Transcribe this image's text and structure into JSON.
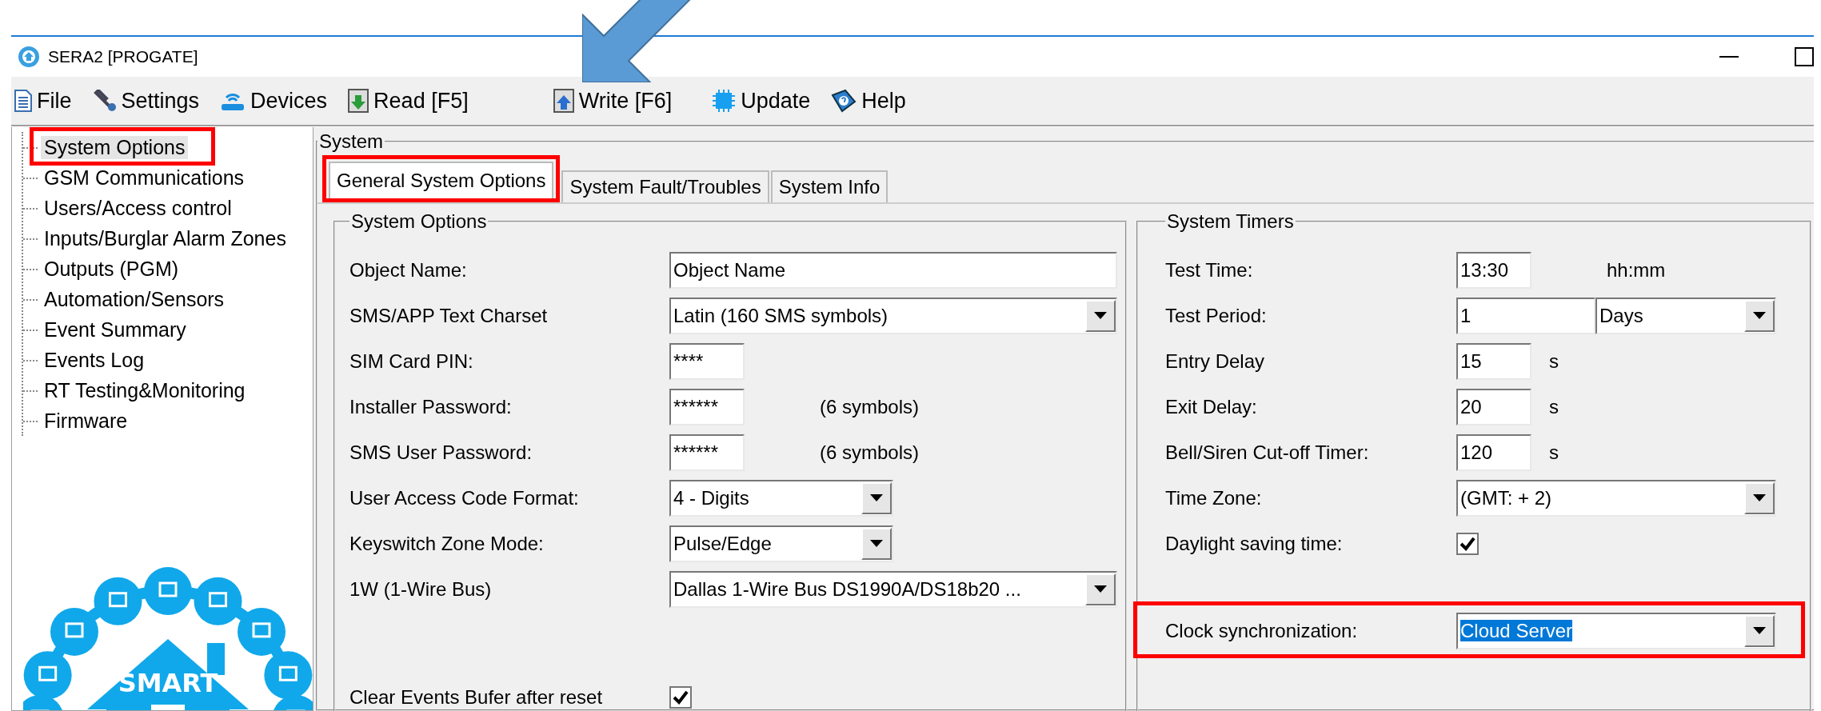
{
  "window": {
    "title": "SERA2 [PROGATE]"
  },
  "menu": [
    {
      "label": "File"
    },
    {
      "label": "Settings"
    },
    {
      "label": "Devices"
    },
    {
      "label": "Read [F5]"
    },
    {
      "label": "Write [F6]"
    },
    {
      "label": "Update"
    },
    {
      "label": "Help"
    }
  ],
  "sidebar": {
    "items": [
      {
        "label": "System Options",
        "selected": true,
        "highlighted": true
      },
      {
        "label": "GSM Communications",
        "selected": false,
        "highlighted": false
      },
      {
        "label": "Users/Access control",
        "selected": false,
        "highlighted": false
      },
      {
        "label": "Inputs/Burglar Alarm Zones",
        "selected": false,
        "highlighted": false
      },
      {
        "label": "Outputs (PGM)",
        "selected": false,
        "highlighted": false
      },
      {
        "label": "Automation/Sensors",
        "selected": false,
        "highlighted": false
      },
      {
        "label": "Event Summary",
        "selected": false,
        "highlighted": false
      },
      {
        "label": "Events Log",
        "selected": false,
        "highlighted": false
      },
      {
        "label": "RT Testing&Monitoring",
        "selected": false,
        "highlighted": false
      },
      {
        "label": "Firmware",
        "selected": false,
        "highlighted": false
      }
    ],
    "logo": {
      "text": "SMART"
    }
  },
  "panel": {
    "title": "System",
    "tabs": [
      {
        "label": "General System Options",
        "selected": true,
        "highlighted": true
      },
      {
        "label": "System Fault/Troubles",
        "selected": false,
        "highlighted": false
      },
      {
        "label": "System Info",
        "selected": false,
        "highlighted": false
      }
    ]
  },
  "system_options": {
    "title": "System Options",
    "rows": [
      {
        "kind": "text",
        "label": "Object Name:",
        "value": "Object Name"
      },
      {
        "kind": "select",
        "label": "SMS/APP Text Charset",
        "value": "Latin (160 SMS symbols)"
      },
      {
        "kind": "short-text",
        "label": "SIM Card PIN:",
        "value": "****"
      },
      {
        "kind": "short-text",
        "label": "Installer Password:",
        "value": "******",
        "note": "(6 symbols)"
      },
      {
        "kind": "short-text",
        "label": "SMS User Password:",
        "value": "******",
        "note": "(6 symbols)"
      },
      {
        "kind": "short-select",
        "label": "User Access Code Format:",
        "value": "4 - Digits"
      },
      {
        "kind": "short-select",
        "label": "Keyswitch Zone Mode:",
        "value": "Pulse/Edge"
      },
      {
        "kind": "select",
        "label": "1W (1-Wire Bus)",
        "value": "Dallas 1-Wire Bus  DS1990A/DS18b20 ..."
      }
    ],
    "extra_rows": [
      {
        "kind": "checkbox",
        "label": "Clear Events Bufer after reset",
        "checked": true
      }
    ]
  },
  "system_timers": {
    "title": "System Timers",
    "rows": [
      {
        "kind": "short-text",
        "label": "Test Time:",
        "value": "13:30",
        "note": "hh:mm"
      },
      {
        "kind": "split",
        "label": "Test Period:",
        "value": "1",
        "option": "Days"
      },
      {
        "kind": "short-text",
        "label": "Entry Delay",
        "value": "15",
        "note": "s"
      },
      {
        "kind": "short-text",
        "label": "Exit Delay:",
        "value": "20",
        "note": "s"
      },
      {
        "kind": "short-text",
        "label": "Bell/Siren Cut-off Timer:",
        "value": "120",
        "note": "s"
      },
      {
        "kind": "select",
        "label": "Time Zone:",
        "value": "(GMT: +  2)"
      },
      {
        "kind": "checkbox",
        "label": "Daylight saving time:",
        "checked": true
      }
    ],
    "extra_rows": [
      {
        "kind": "select",
        "label": "Clock synchronization:",
        "value": "Cloud Server",
        "value_selected": true,
        "highlighted": true
      }
    ]
  }
}
